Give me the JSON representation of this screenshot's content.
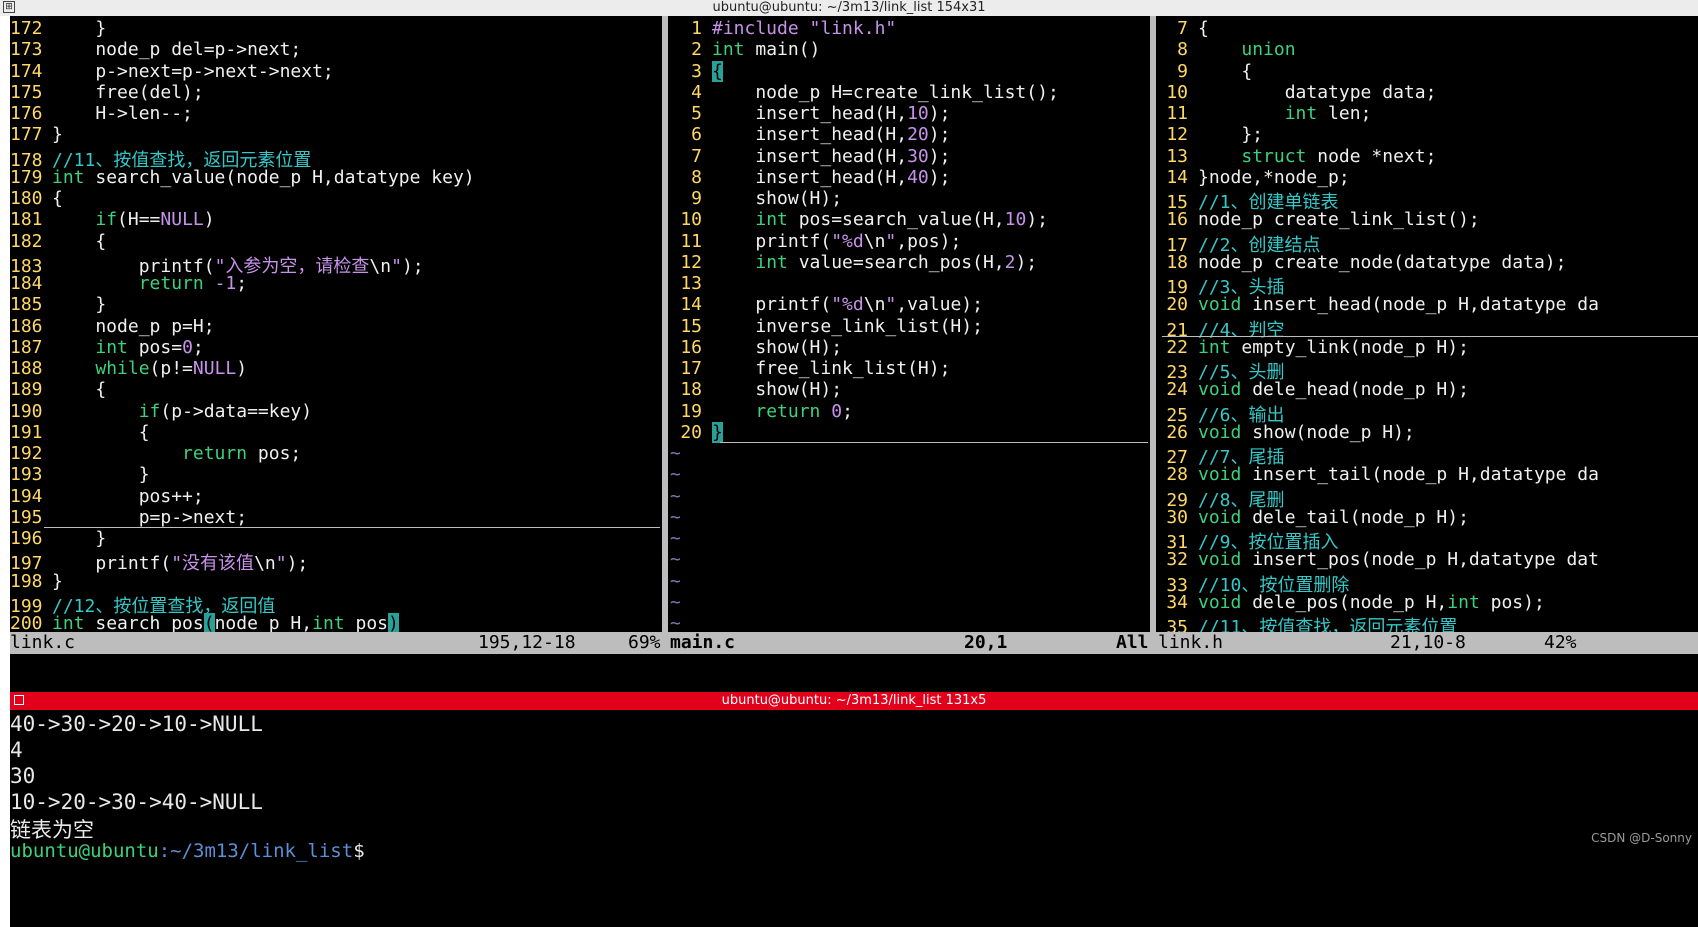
{
  "window": {
    "title": "ubuntu@ubuntu: ~/3m13/link_list 154x31"
  },
  "panes": {
    "left": {
      "lines": [
        {
          "n": "172",
          "segs": [
            {
              "t": "    }"
            }
          ]
        },
        {
          "n": "173",
          "segs": [
            {
              "t": "    node_p del=p->next;"
            }
          ]
        },
        {
          "n": "174",
          "segs": [
            {
              "t": "    p->next=p->next->next;"
            }
          ]
        },
        {
          "n": "175",
          "segs": [
            {
              "t": "    free(del);"
            }
          ]
        },
        {
          "n": "176",
          "segs": [
            {
              "t": "    H->len--;"
            }
          ]
        },
        {
          "n": "177",
          "segs": [
            {
              "t": "}"
            }
          ]
        },
        {
          "n": "178",
          "segs": [
            {
              "t": "//11、按值查找，返回元素位置",
              "c": "cm"
            }
          ]
        },
        {
          "n": "179",
          "segs": [
            {
              "t": "int",
              "c": "ty"
            },
            {
              "t": " search_value(node_p H,datatype key)"
            }
          ]
        },
        {
          "n": "180",
          "segs": [
            {
              "t": "{"
            }
          ]
        },
        {
          "n": "181",
          "segs": [
            {
              "t": "    "
            },
            {
              "t": "if",
              "c": "kw"
            },
            {
              "t": "(H=="
            },
            {
              "t": "NULL",
              "c": "num"
            },
            {
              "t": ")"
            }
          ]
        },
        {
          "n": "182",
          "segs": [
            {
              "t": "    {"
            }
          ]
        },
        {
          "n": "183",
          "segs": [
            {
              "t": "        printf("
            },
            {
              "t": "\"入参为空，请检查",
              "c": "str"
            },
            {
              "t": "\\n",
              "c": "esc"
            },
            {
              "t": "\"",
              "c": "str"
            },
            {
              "t": ");"
            }
          ]
        },
        {
          "n": "184",
          "segs": [
            {
              "t": "        "
            },
            {
              "t": "return",
              "c": "kw"
            },
            {
              "t": " "
            },
            {
              "t": "-1",
              "c": "num"
            },
            {
              "t": ";"
            }
          ]
        },
        {
          "n": "185",
          "segs": [
            {
              "t": "    }"
            }
          ]
        },
        {
          "n": "186",
          "segs": [
            {
              "t": "    node_p p=H;"
            }
          ]
        },
        {
          "n": "187",
          "segs": [
            {
              "t": "    "
            },
            {
              "t": "int",
              "c": "ty"
            },
            {
              "t": " pos="
            },
            {
              "t": "0",
              "c": "num"
            },
            {
              "t": ";"
            }
          ]
        },
        {
          "n": "188",
          "segs": [
            {
              "t": "    "
            },
            {
              "t": "while",
              "c": "kw"
            },
            {
              "t": "(p!="
            },
            {
              "t": "NULL",
              "c": "num"
            },
            {
              "t": ")"
            }
          ]
        },
        {
          "n": "189",
          "segs": [
            {
              "t": "    {"
            }
          ]
        },
        {
          "n": "190",
          "segs": [
            {
              "t": "        "
            },
            {
              "t": "if",
              "c": "kw"
            },
            {
              "t": "(p->data==key)"
            }
          ]
        },
        {
          "n": "191",
          "segs": [
            {
              "t": "        {"
            }
          ]
        },
        {
          "n": "192",
          "segs": [
            {
              "t": "            "
            },
            {
              "t": "return",
              "c": "kw"
            },
            {
              "t": " pos;"
            }
          ]
        },
        {
          "n": "193",
          "segs": [
            {
              "t": "        }"
            }
          ]
        },
        {
          "n": "194",
          "segs": [
            {
              "t": "        pos++;"
            }
          ]
        },
        {
          "n": "195",
          "segs": [
            {
              "t": "        p=p->next;"
            }
          ]
        },
        {
          "n": "196",
          "segs": [
            {
              "t": "    }"
            }
          ]
        },
        {
          "n": "197",
          "segs": [
            {
              "t": "    printf("
            },
            {
              "t": "\"没有该值",
              "c": "str"
            },
            {
              "t": "\\n",
              "c": "esc"
            },
            {
              "t": "\"",
              "c": "str"
            },
            {
              "t": ");"
            }
          ]
        },
        {
          "n": "198",
          "segs": [
            {
              "t": "}"
            }
          ]
        },
        {
          "n": "199",
          "segs": [
            {
              "t": "//12、按位置查找，返回值",
              "c": "cm"
            }
          ]
        },
        {
          "n": "200",
          "segs": [
            {
              "t": "int",
              "c": "ty"
            },
            {
              "t": " search_pos"
            },
            {
              "t": "(",
              "c": "brk"
            },
            {
              "t": "node_p H,"
            },
            {
              "t": "int",
              "c": "ty"
            },
            {
              "t": " pos"
            },
            {
              "t": ")",
              "c": "brk"
            }
          ]
        }
      ],
      "status": {
        "file": "link.c",
        "pos": "195,12-18",
        "pct": "69%"
      }
    },
    "middle": {
      "lines": [
        {
          "n": "1",
          "segs": [
            {
              "t": "#include",
              "c": "pp"
            },
            {
              "t": " "
            },
            {
              "t": "\"link.h\"",
              "c": "str"
            }
          ]
        },
        {
          "n": "2",
          "segs": [
            {
              "t": "int",
              "c": "ty"
            },
            {
              "t": " main()"
            }
          ]
        },
        {
          "n": "3",
          "segs": [
            {
              "t": "{",
              "c": "brk"
            }
          ]
        },
        {
          "n": "4",
          "segs": [
            {
              "t": "    node_p H=create_link_list();"
            }
          ]
        },
        {
          "n": "5",
          "segs": [
            {
              "t": "    insert_head(H,"
            },
            {
              "t": "10",
              "c": "num"
            },
            {
              "t": ");"
            }
          ]
        },
        {
          "n": "6",
          "segs": [
            {
              "t": "    insert_head(H,"
            },
            {
              "t": "20",
              "c": "num"
            },
            {
              "t": ");"
            }
          ]
        },
        {
          "n": "7",
          "segs": [
            {
              "t": "    insert_head(H,"
            },
            {
              "t": "30",
              "c": "num"
            },
            {
              "t": ");"
            }
          ]
        },
        {
          "n": "8",
          "segs": [
            {
              "t": "    insert_head(H,"
            },
            {
              "t": "40",
              "c": "num"
            },
            {
              "t": ");"
            }
          ]
        },
        {
          "n": "9",
          "segs": [
            {
              "t": "    show(H);"
            }
          ]
        },
        {
          "n": "10",
          "segs": [
            {
              "t": "    "
            },
            {
              "t": "int",
              "c": "ty"
            },
            {
              "t": " pos=search_value(H,"
            },
            {
              "t": "10",
              "c": "num"
            },
            {
              "t": ");"
            }
          ]
        },
        {
          "n": "11",
          "segs": [
            {
              "t": "    printf("
            },
            {
              "t": "\"%d",
              "c": "str"
            },
            {
              "t": "\\n",
              "c": "esc"
            },
            {
              "t": "\"",
              "c": "str"
            },
            {
              "t": ",pos);"
            }
          ]
        },
        {
          "n": "12",
          "segs": [
            {
              "t": "    "
            },
            {
              "t": "int",
              "c": "ty"
            },
            {
              "t": " value=search_pos(H,"
            },
            {
              "t": "2",
              "c": "num"
            },
            {
              "t": ");"
            }
          ]
        },
        {
          "n": "13",
          "segs": [
            {
              "t": ""
            }
          ]
        },
        {
          "n": "14",
          "segs": [
            {
              "t": "    printf("
            },
            {
              "t": "\"%d",
              "c": "str"
            },
            {
              "t": "\\n",
              "c": "esc"
            },
            {
              "t": "\"",
              "c": "str"
            },
            {
              "t": ",value);"
            }
          ]
        },
        {
          "n": "15",
          "segs": [
            {
              "t": "    inverse_link_list(H);"
            }
          ]
        },
        {
          "n": "16",
          "segs": [
            {
              "t": "    show(H);"
            }
          ]
        },
        {
          "n": "17",
          "segs": [
            {
              "t": "    free_link_list(H);"
            }
          ]
        },
        {
          "n": "18",
          "segs": [
            {
              "t": "    show(H);"
            }
          ]
        },
        {
          "n": "19",
          "segs": [
            {
              "t": "    "
            },
            {
              "t": "return",
              "c": "kw"
            },
            {
              "t": " "
            },
            {
              "t": "0",
              "c": "num"
            },
            {
              "t": ";"
            }
          ]
        },
        {
          "n": "20",
          "segs": [
            {
              "t": "}",
              "c": "brk"
            }
          ]
        }
      ],
      "tilde": "~",
      "status": {
        "file": "main.c",
        "pos": "20,1",
        "pct": "All"
      }
    },
    "right": {
      "lines": [
        {
          "n": "7",
          "segs": [
            {
              "t": "{"
            }
          ]
        },
        {
          "n": "8",
          "segs": [
            {
              "t": "    "
            },
            {
              "t": "union",
              "c": "ty"
            }
          ]
        },
        {
          "n": "9",
          "segs": [
            {
              "t": "    {"
            }
          ]
        },
        {
          "n": "10",
          "segs": [
            {
              "t": "        datatype data;"
            }
          ]
        },
        {
          "n": "11",
          "segs": [
            {
              "t": "        "
            },
            {
              "t": "int",
              "c": "ty"
            },
            {
              "t": " len;"
            }
          ]
        },
        {
          "n": "12",
          "segs": [
            {
              "t": "    };"
            }
          ]
        },
        {
          "n": "13",
          "segs": [
            {
              "t": "    "
            },
            {
              "t": "struct",
              "c": "ty"
            },
            {
              "t": " node *next;"
            }
          ]
        },
        {
          "n": "14",
          "segs": [
            {
              "t": "}node,*node_p;"
            }
          ]
        },
        {
          "n": "15",
          "segs": [
            {
              "t": "//1、创建单链表",
              "c": "cm"
            }
          ]
        },
        {
          "n": "16",
          "segs": [
            {
              "t": "node_p create_link_list();"
            }
          ]
        },
        {
          "n": "17",
          "segs": [
            {
              "t": "//2、创建结点",
              "c": "cm"
            }
          ]
        },
        {
          "n": "18",
          "segs": [
            {
              "t": "node_p create_node(datatype data);"
            }
          ]
        },
        {
          "n": "19",
          "segs": [
            {
              "t": "//3、头插",
              "c": "cm"
            }
          ]
        },
        {
          "n": "20",
          "segs": [
            {
              "t": "void",
              "c": "ty"
            },
            {
              "t": " insert_head(node_p H,datatype da"
            }
          ]
        },
        {
          "n": "21",
          "segs": [
            {
              "t": "//4、判空",
              "c": "cm"
            }
          ]
        },
        {
          "n": "22",
          "segs": [
            {
              "t": "int",
              "c": "ty"
            },
            {
              "t": " empty_link(node_p H);"
            }
          ]
        },
        {
          "n": "23",
          "segs": [
            {
              "t": "//5、头删",
              "c": "cm"
            }
          ]
        },
        {
          "n": "24",
          "segs": [
            {
              "t": "void",
              "c": "ty"
            },
            {
              "t": " dele_head(node_p H);"
            }
          ]
        },
        {
          "n": "25",
          "segs": [
            {
              "t": "//6、输出",
              "c": "cm"
            }
          ]
        },
        {
          "n": "26",
          "segs": [
            {
              "t": "void",
              "c": "ty"
            },
            {
              "t": " show(node_p H);"
            }
          ]
        },
        {
          "n": "27",
          "segs": [
            {
              "t": "//7、尾插",
              "c": "cm"
            }
          ]
        },
        {
          "n": "28",
          "segs": [
            {
              "t": "void",
              "c": "ty"
            },
            {
              "t": " insert_tail(node_p H,datatype da"
            }
          ]
        },
        {
          "n": "29",
          "segs": [
            {
              "t": "//8、尾删",
              "c": "cm"
            }
          ]
        },
        {
          "n": "30",
          "segs": [
            {
              "t": "void",
              "c": "ty"
            },
            {
              "t": " dele_tail(node_p H);"
            }
          ]
        },
        {
          "n": "31",
          "segs": [
            {
              "t": "//9、按位置插入",
              "c": "cm"
            }
          ]
        },
        {
          "n": "32",
          "segs": [
            {
              "t": "void",
              "c": "ty"
            },
            {
              "t": " insert_pos(node_p H,datatype dat"
            }
          ]
        },
        {
          "n": "33",
          "segs": [
            {
              "t": "//10、按位置删除",
              "c": "cm"
            }
          ]
        },
        {
          "n": "34",
          "segs": [
            {
              "t": "void",
              "c": "ty"
            },
            {
              "t": " dele_pos(node_p H,"
            },
            {
              "t": "int",
              "c": "ty"
            },
            {
              "t": " pos);"
            }
          ]
        },
        {
          "n": "35",
          "segs": [
            {
              "t": "//11、按值查找，返回元素位置",
              "c": "cm"
            }
          ]
        }
      ],
      "status": {
        "file": "link.h",
        "pos": "21,10-8",
        "pct": "42%"
      }
    }
  },
  "terminal2": {
    "title": "ubuntu@ubuntu: ~/3m13/link_list 131x5",
    "output": [
      "40->30->20->10->NULL",
      "4",
      "30",
      "10->20->30->40->NULL",
      "链表为空"
    ],
    "prompt_user": "ubuntu@ubuntu",
    "prompt_path": ":~/3m13/link_list",
    "prompt_suffix": "$"
  },
  "watermark": "CSDN @D-Sonny",
  "colors": {
    "line_number": "#ffd866",
    "keyword": "#3dd17d",
    "comment": "#35c8c8",
    "string": "#c792ea",
    "title_bar_active": "#e3001b",
    "status_bar": "#bdbdbd"
  }
}
